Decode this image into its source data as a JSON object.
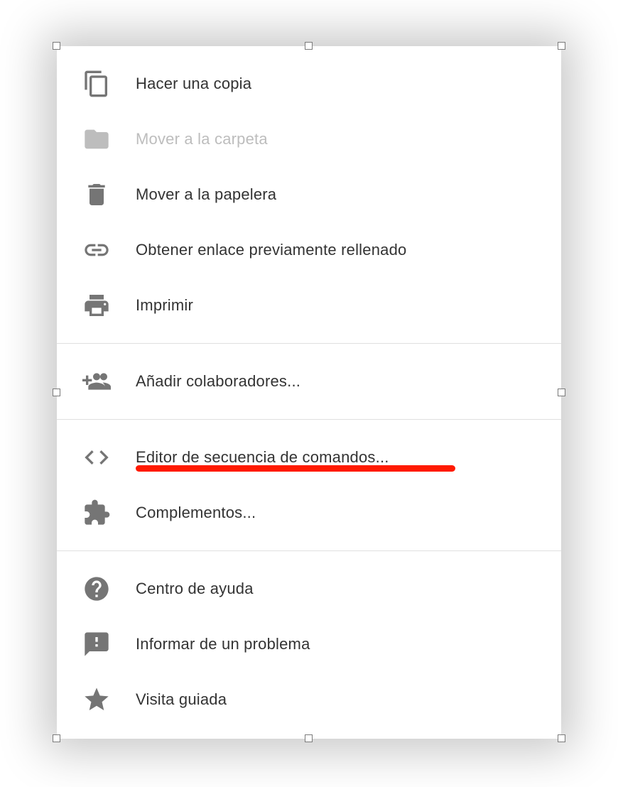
{
  "menu": {
    "make_copy": "Hacer una copia",
    "move_to_folder": "Mover a la carpeta",
    "move_to_trash": "Mover a la papelera",
    "get_prefilled_link": "Obtener enlace previamente rellenado",
    "print": "Imprimir",
    "add_collaborators": "Añadir colaboradores...",
    "script_editor": "Editor de secuencia de comandos...",
    "addons": "Complementos...",
    "help_center": "Centro de ayuda",
    "report_problem": "Informar de un problema",
    "guided_tour": "Visita guiada"
  }
}
